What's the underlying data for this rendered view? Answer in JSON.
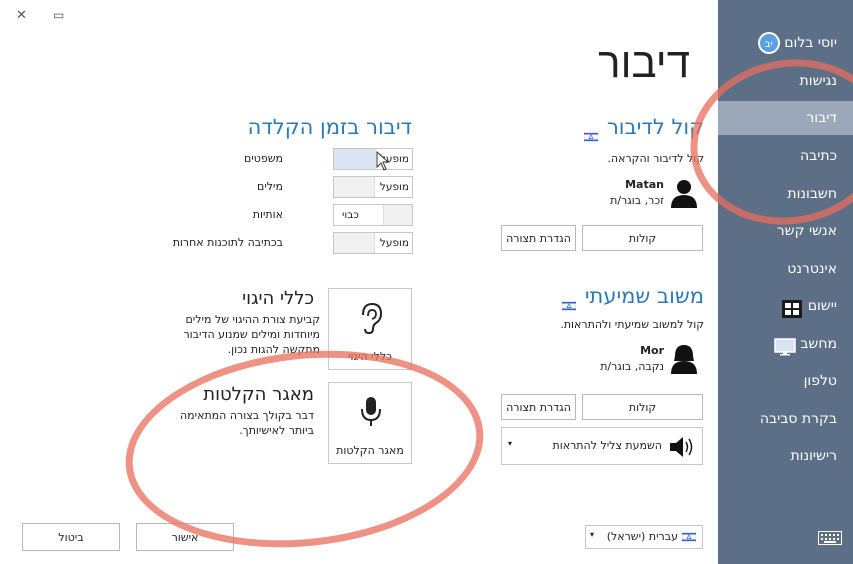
{
  "window": {
    "close_glyph": "✕",
    "restore_glyph": "▭"
  },
  "page_title": "דיבור",
  "sidebar": {
    "user_name": "יוסי בלום",
    "user_initials": "יב",
    "items": [
      {
        "label": "נגישות"
      },
      {
        "label": "דיבור",
        "selected": true
      },
      {
        "label": "כתיבה"
      },
      {
        "label": "חשבונות"
      },
      {
        "label": "אנשי קשר"
      },
      {
        "label": "אינטרנט"
      },
      {
        "label": "יישום",
        "icon": "windows-logo-icon"
      },
      {
        "label": "מחשב",
        "icon": "monitor-icon"
      },
      {
        "label": "טלפון"
      },
      {
        "label": "בקרת סביבה"
      },
      {
        "label": "רישיונות"
      }
    ],
    "keyboard_icon": "keyboard-icon"
  },
  "speech_voice": {
    "title": "קול לדיבור",
    "description": "קול לדיבור והקראה.",
    "voice_name": "Matan",
    "voice_details": "זכר, בוגר/ת",
    "voices_button": "קולות",
    "preview_button": "הגדרת תצורה"
  },
  "auditory_feedback": {
    "title": "משוב שמיעתי",
    "description": "קול למשוב שמיעתי ולהתראות.",
    "voice_name": "Mor",
    "voice_details": "נקבה, בוגר/ת",
    "voices_button": "קולות",
    "preview_button": "הגדרת תצורה",
    "alert_sound_label": "השמעת צליל להתראות"
  },
  "speech_while_typing": {
    "title": "דיבור בזמן הקלדה",
    "rows": [
      {
        "label": "משפטים",
        "state": "מופעל",
        "highlighted": true
      },
      {
        "label": "מילים",
        "state": "מופעל"
      },
      {
        "label": "אותיות",
        "state": "כבוי",
        "off": true
      },
      {
        "label": "בכתיבה לתוכנות אחרות",
        "state": "מופעל"
      }
    ]
  },
  "pronunciation_rules": {
    "title": "כללי היגוי",
    "description_lines": [
      "קביעת צורת ההיגוי של מילים",
      "מיוחדות ומילים שמנוע הדיבור",
      "מתקשה להגות נכון."
    ],
    "tile_label": "כללי היגוי"
  },
  "recording_library": {
    "title": "מאגר הקלטות",
    "description_lines": [
      "דבר בקולך בצורה המתאימה",
      "ביותר לאישיותך."
    ],
    "tile_label": "מאגר הקלטות"
  },
  "footer": {
    "ok_button": "אישור",
    "cancel_button": "ביטול",
    "language": "עברית (ישראל)"
  },
  "colors": {
    "sidebar_bg": "#5c6f86",
    "sidebar_selected": "#9aa8b9",
    "accent_blue": "#2a7ab8",
    "annotation_red": "#e86e5c"
  }
}
